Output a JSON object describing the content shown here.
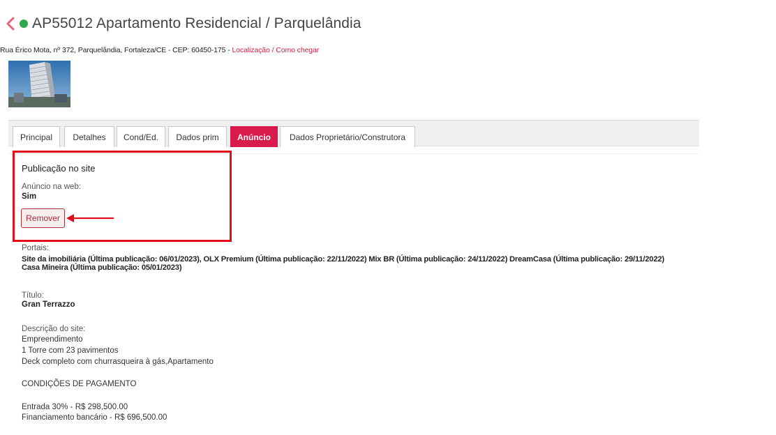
{
  "header": {
    "back_icon": "chevron-left-icon",
    "status_color": "#2fa84f",
    "title": "AP55012 Apartamento Residencial / Parquelândia"
  },
  "address": {
    "text": "Rua Érico Mota, nº 372, Parquelândia, Fortaleza/CE - CEP: 60450-175 - ",
    "location_link": "Localização",
    "separator": " / ",
    "directions_link": "Como chegar"
  },
  "tabs": [
    {
      "label": "Principal"
    },
    {
      "label": "Detalhes"
    },
    {
      "label": "Cond/Ed."
    },
    {
      "label": "Dados prim"
    },
    {
      "label": "Anúncio",
      "active": true
    },
    {
      "label": "Dados Proprietário/Construtora"
    }
  ],
  "publication": {
    "section_title": "Publicação no site",
    "web_label": "Anúncio na web:",
    "web_value": "Sim",
    "remove_label": "Remover"
  },
  "portais": {
    "label": "Portais:",
    "line1": "Site da imobiliária (Última publicação: 06/01/2023), OLX Premium (Última publicação: 22/11/2022) Mix BR (Última publicação: 24/11/2022) DreamCasa (Última publicação: 29/11/2022)",
    "line2": "Casa Mineira (Última publicação: 05/01/2023)"
  },
  "titulo": {
    "label": "Título:",
    "value": "Gran Terrazzo"
  },
  "descricao": {
    "label": "Descrição do site:",
    "lines": [
      "Empreendimento",
      "1 Torre com 23 pavimentos",
      "Deck completo com churrasqueira à gás,Apartamento",
      "CONDIÇÕES DE PAGAMENTO",
      "Entrada 30% - R$ 298,500.00",
      "Financiamento bancário - R$ 696,500.00"
    ]
  },
  "colors": {
    "accent": "#d81b4a",
    "link": "#d81b3f",
    "highlight": "#e0101a"
  }
}
